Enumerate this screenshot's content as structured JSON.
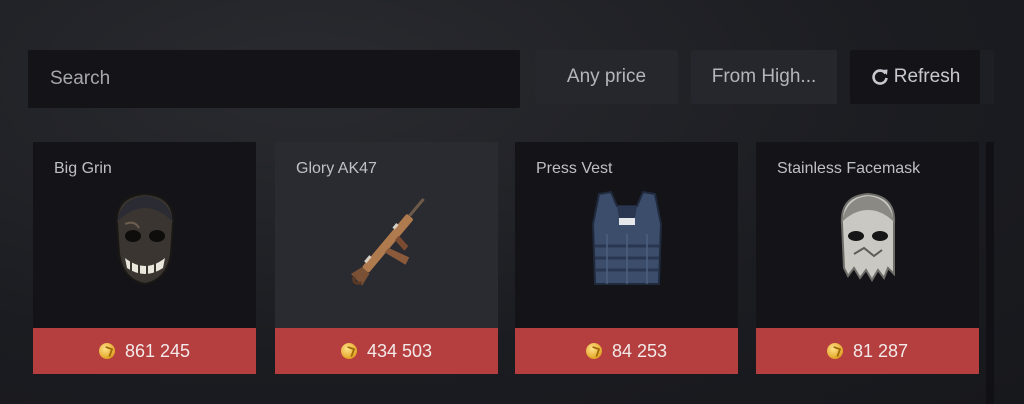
{
  "search": {
    "placeholder": "Search",
    "value": ""
  },
  "filters": {
    "price_label": "Any price",
    "sort_label": "From High...",
    "refresh_label": "Refresh"
  },
  "items": [
    {
      "name": "Big Grin",
      "price": "861 245",
      "icon": "big-grin-mask"
    },
    {
      "name": "Glory AK47",
      "price": "434 503",
      "icon": "glory-ak47-rifle"
    },
    {
      "name": "Press Vest",
      "price": "84 253",
      "icon": "press-vest"
    },
    {
      "name": "Stainless Facemask",
      "price": "81 287",
      "icon": "stainless-facemask"
    }
  ],
  "colors": {
    "price_bar": "#b53f3f",
    "card_bg": "#131318",
    "card_hover_bg": "#2a2b31",
    "coin": "#e2a527"
  }
}
